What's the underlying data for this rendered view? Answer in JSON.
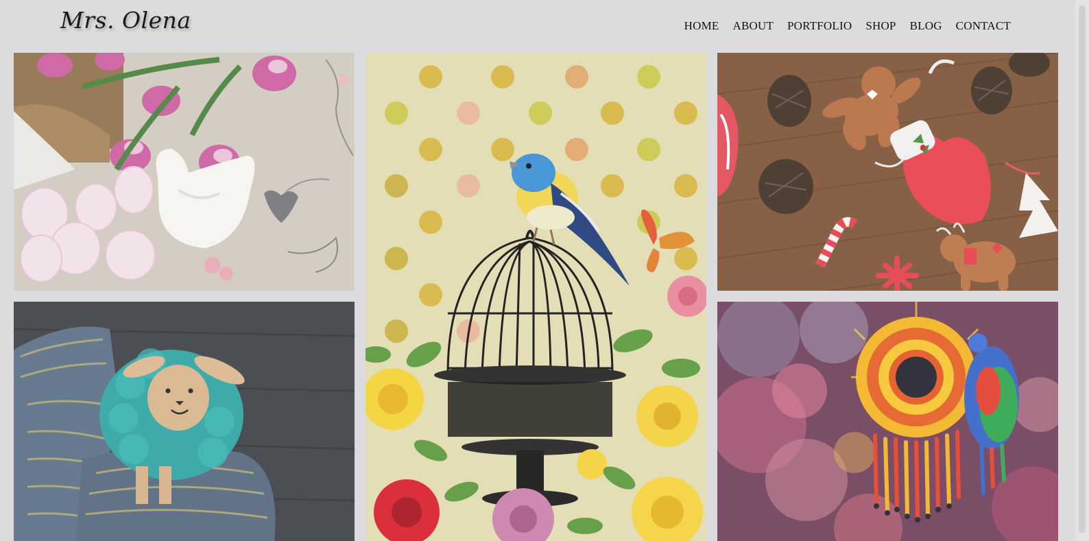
{
  "site": {
    "logo": "Mrs. Olena"
  },
  "nav": {
    "items": [
      {
        "label": "HOME"
      },
      {
        "label": "ABOUT"
      },
      {
        "label": "PORTFOLIO"
      },
      {
        "label": "SHOP"
      },
      {
        "label": "BLOG"
      },
      {
        "label": "CONTACT"
      }
    ]
  },
  "gallery": {
    "tiles": [
      {
        "subject": "easter-eggs-and-hen"
      },
      {
        "subject": "bird-on-birdcage-with-roses"
      },
      {
        "subject": "felt-christmas-ornaments"
      },
      {
        "subject": "wool-sheep-toy"
      },
      {
        "subject": "beaded-flower-earrings"
      }
    ]
  },
  "colors": {
    "page_background": "#dcdcdf",
    "text": "#111111"
  }
}
